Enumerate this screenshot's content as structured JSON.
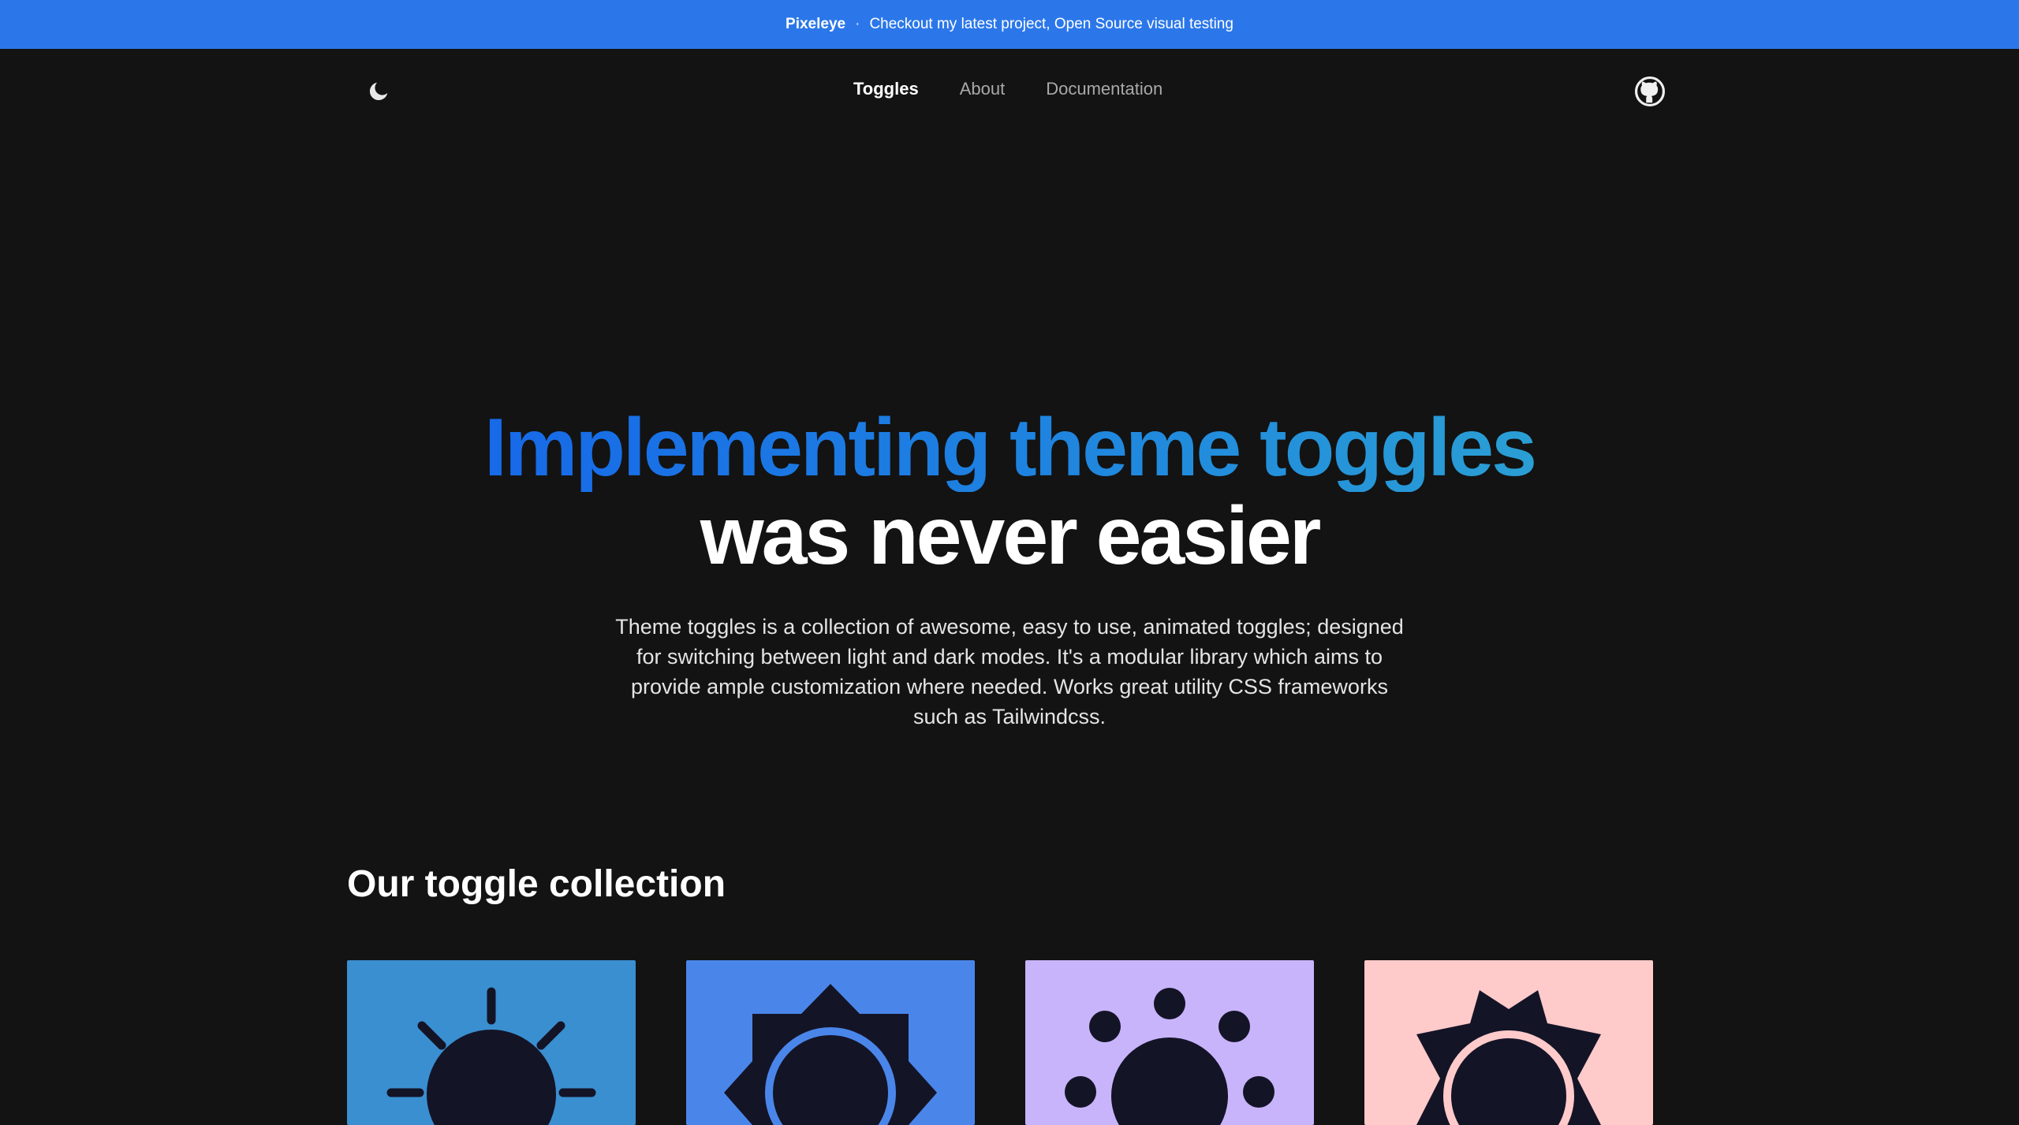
{
  "banner": {
    "brand": "Pixeleye",
    "separator": "·",
    "message": "Checkout my latest project, Open Source visual testing"
  },
  "nav": {
    "theme_icon": "moon-icon",
    "github_icon": "github-icon",
    "links": [
      {
        "label": "Toggles",
        "active": true
      },
      {
        "label": "About",
        "active": false
      },
      {
        "label": "Documentation",
        "active": false
      }
    ]
  },
  "hero": {
    "title_line1": "Implementing theme toggles",
    "title_line2": "was never easier",
    "description": "Theme toggles is a collection of awesome, easy to use, animated toggles; designed for switching between light and dark modes. It's a modular library which aims to provide ample customization where needed. Works great utility CSS frameworks such as Tailwindcss."
  },
  "collection": {
    "title": "Our toggle collection",
    "cards": [
      {
        "icon": "sun-rays-icon",
        "color": "#3a8fd0"
      },
      {
        "icon": "sun-star-ring-icon",
        "color": "#4a86ea"
      },
      {
        "icon": "sun-dots-icon",
        "color": "#c8b4fb"
      },
      {
        "icon": "sun-crown-ring-icon",
        "color": "#fecaca"
      }
    ]
  },
  "colors": {
    "background": "#131313",
    "banner": "#2b77ea",
    "icon_dark": "#141427"
  }
}
